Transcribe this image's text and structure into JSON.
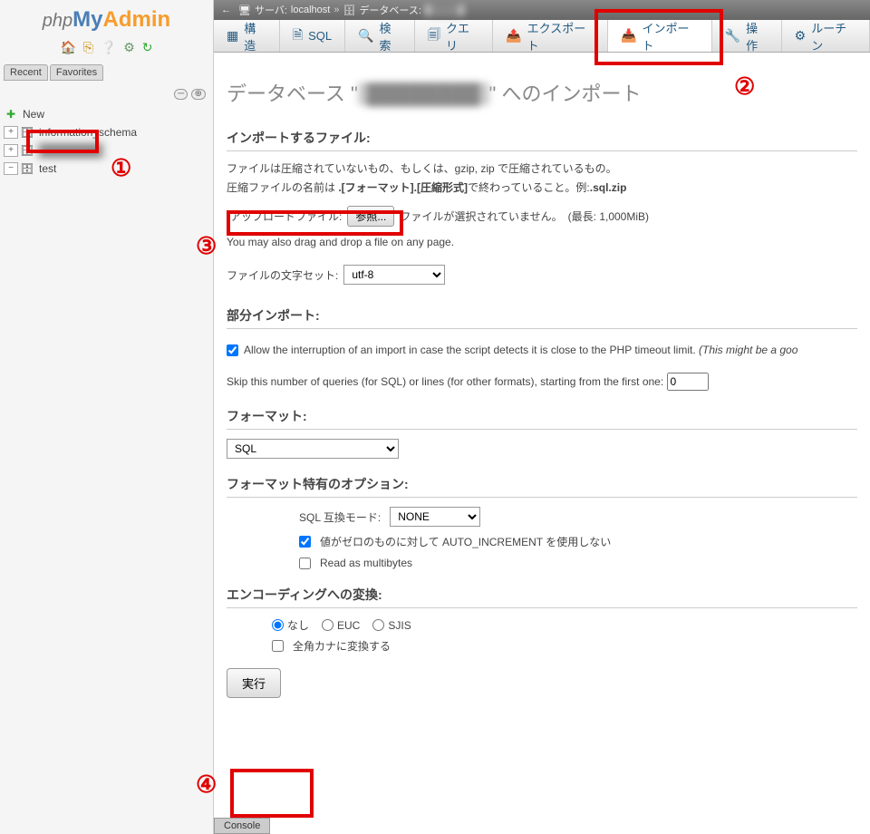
{
  "logo": {
    "php": "php",
    "my": "My",
    "admin": "Admin"
  },
  "sidebar": {
    "tabs": {
      "recent": "Recent",
      "favorites": "Favorites"
    },
    "new": "New",
    "items": [
      {
        "label": "information_schema"
      },
      {
        "label": "████████"
      },
      {
        "label": "test"
      }
    ]
  },
  "breadcrumb": {
    "server_label": "サーバ:",
    "server_value": "localhost",
    "db_label": "データベース:",
    "db_value": "████"
  },
  "tabs": [
    {
      "label": "構造"
    },
    {
      "label": "SQL"
    },
    {
      "label": "検索"
    },
    {
      "label": "クエリ"
    },
    {
      "label": "エクスポート"
    },
    {
      "label": "インポート"
    },
    {
      "label": "操作"
    },
    {
      "label": "ルーチン"
    }
  ],
  "page": {
    "title_prefix": "データベース \"",
    "title_db": "████████",
    "title_suffix": "\" へのインポート"
  },
  "import_file": {
    "heading": "インポートするファイル:",
    "desc1": "ファイルは圧縮されていないもの、もしくは、gzip, zip で圧縮されているもの。",
    "desc2_a": "圧縮ファイルの名前は ",
    "desc2_b": ".[フォーマット].[圧縮形式]",
    "desc2_c": "で終わっていること。例:",
    "desc2_d": ".sql.zip",
    "upload_label": "アップロードファイル:",
    "browse": "参照...",
    "nofile": "ファイルが選択されていません。",
    "maxlen": "(最長: 1,000MiB)",
    "dragdrop": "You may also drag and drop a file on any page.",
    "charset_label": "ファイルの文字セット:",
    "charset_value": "utf-8"
  },
  "partial": {
    "heading": "部分インポート:",
    "interrupt": "Allow the interruption of an import in case the script detects it is close to the PHP timeout limit.",
    "interrupt_note": "(This might be a goo",
    "skip_label": "Skip this number of queries (for SQL) or lines (for other formats), starting from the first one:",
    "skip_value": "0"
  },
  "format": {
    "heading": "フォーマット:",
    "value": "SQL"
  },
  "fso": {
    "heading": "フォーマット特有のオプション:",
    "mode_label": "SQL 互換モード:",
    "mode_value": "NONE",
    "auto_inc": "値がゼロのものに対して AUTO_INCREMENT を使用しない",
    "multibyte": "Read as multibytes"
  },
  "encoding": {
    "heading": "エンコーディングへの変換:",
    "none": "なし",
    "euc": "EUC",
    "sjis": "SJIS",
    "zenkaku": "全角カナに変換する"
  },
  "execute": "実行",
  "console": "Console",
  "ann": {
    "n1": "①",
    "n2": "②",
    "n3": "③",
    "n4": "④"
  }
}
